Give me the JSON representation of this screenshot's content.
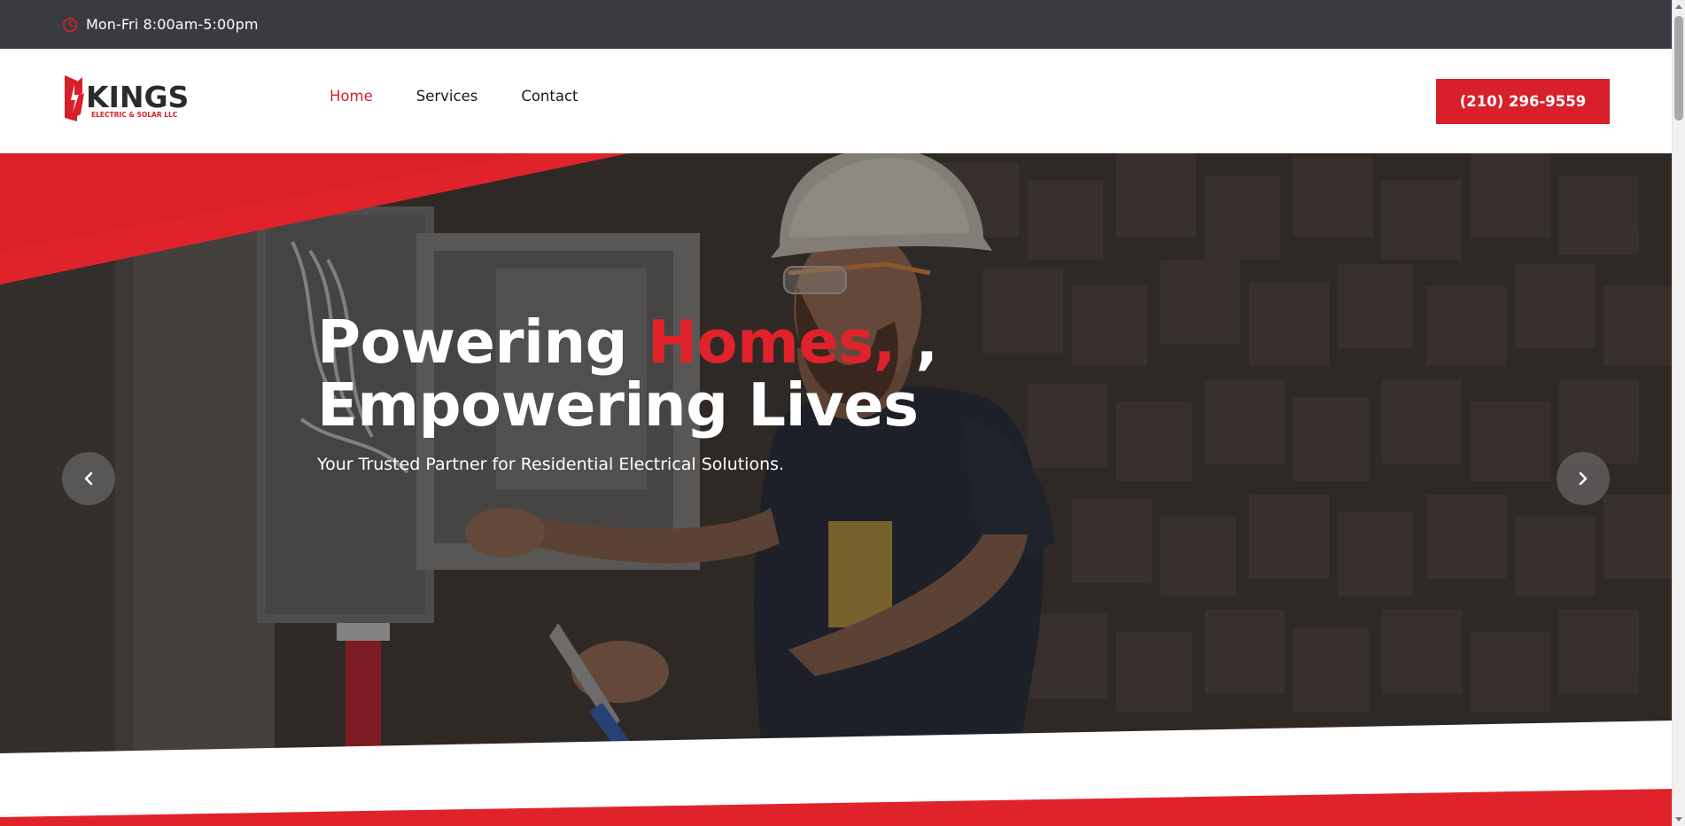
{
  "topbar": {
    "hours": "Mon-Fri 8:00am-5:00pm",
    "icon": "clock-icon"
  },
  "header": {
    "logo_text": "KINGS",
    "logo_subtext": "ELECTRIC & SOLAR LLC",
    "nav": [
      {
        "label": "Home",
        "active": true
      },
      {
        "label": "Services",
        "active": false
      },
      {
        "label": "Contact",
        "active": false
      }
    ],
    "phone": "(210) 296-9559"
  },
  "hero": {
    "title_part1": "Powering ",
    "title_highlight": "Homes,",
    "title_part2": " ,",
    "title_line2": "Empowering Lives",
    "subtitle": "Your Trusted Partner for Residential Electrical Solutions.",
    "prev_icon": "chevron-left-icon",
    "next_icon": "chevron-right-icon"
  },
  "colors": {
    "accent": "#d9202a",
    "topbar_bg": "#3a3b40",
    "hero_overlay": "#3b3533"
  }
}
